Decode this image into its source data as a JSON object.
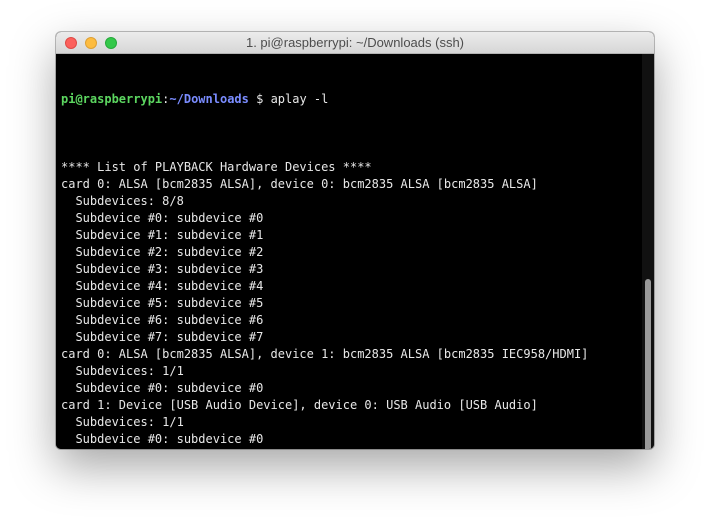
{
  "window": {
    "title": "1. pi@raspberrypi: ~/Downloads (ssh)"
  },
  "prompt": {
    "user_host": "pi@raspberrypi",
    "separator": ":",
    "path": "~/Downloads",
    "symbol": " $ "
  },
  "command": "aplay -l",
  "output": [
    "**** List of PLAYBACK Hardware Devices ****",
    "card 0: ALSA [bcm2835 ALSA], device 0: bcm2835 ALSA [bcm2835 ALSA]",
    "  Subdevices: 8/8",
    "  Subdevice #0: subdevice #0",
    "  Subdevice #1: subdevice #1",
    "  Subdevice #2: subdevice #2",
    "  Subdevice #3: subdevice #3",
    "  Subdevice #4: subdevice #4",
    "  Subdevice #5: subdevice #5",
    "  Subdevice #6: subdevice #6",
    "  Subdevice #7: subdevice #7",
    "card 0: ALSA [bcm2835 ALSA], device 1: bcm2835 ALSA [bcm2835 IEC958/HDMI]",
    "  Subdevices: 1/1",
    "  Subdevice #0: subdevice #0",
    "card 1: Device [USB Audio Device], device 0: USB Audio [USB Audio]",
    "  Subdevices: 1/1",
    "  Subdevice #0: subdevice #0"
  ],
  "colors": {
    "user_host": "#5cd660",
    "path": "#7a8cff",
    "background": "#000000"
  }
}
